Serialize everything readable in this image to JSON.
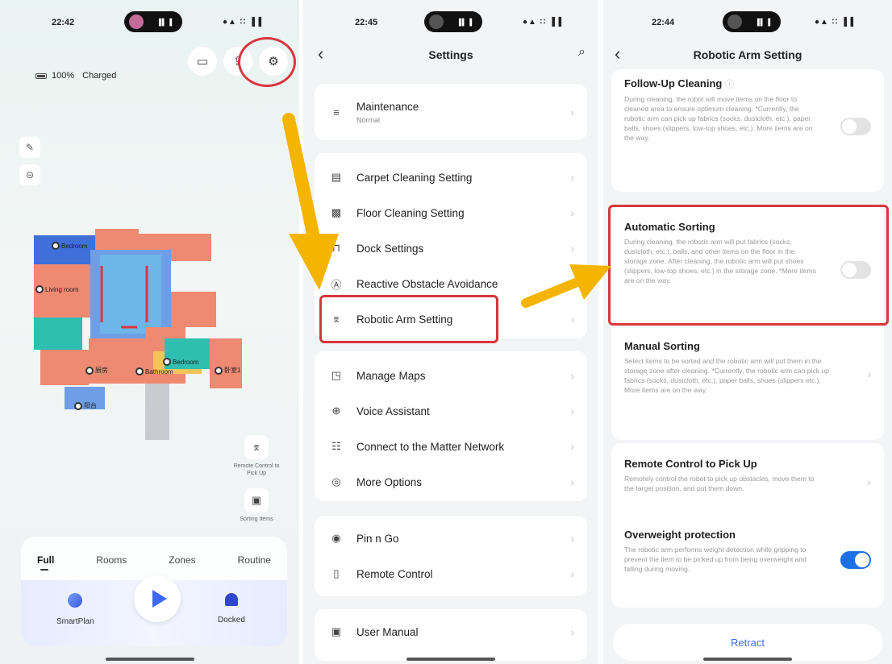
{
  "phone1": {
    "time": "22:42",
    "system_icons": "●▲ ∷ ▐▐",
    "battery": {
      "percent": "100%",
      "status": "Charged"
    },
    "top_icons": [
      "video-icon",
      "share-icon",
      "settings-gear-icon"
    ],
    "map_rooms": [
      {
        "label": "Bedroom"
      },
      {
        "label": "Living room"
      },
      {
        "label": "厨房"
      },
      {
        "label": "Bedroom"
      },
      {
        "label": "Bathroom"
      },
      {
        "label": "卧室1"
      },
      {
        "label": "阳台"
      }
    ],
    "remote_control": {
      "label": "Remote Control to Pick Up"
    },
    "sorting_items": {
      "label": "Sorting Items"
    },
    "mode_tabs": [
      "Full",
      "Rooms",
      "Zones",
      "Routine"
    ],
    "active_tab": "Full",
    "actions": {
      "left": "SmartPlan",
      "right": "Docked"
    }
  },
  "phone2": {
    "time": "22:45",
    "system_icons": "●▲ ∷ ▐▐",
    "title": "Settings",
    "groups": [
      [
        {
          "icon": "layers-icon",
          "glyph": "≡",
          "label": "Maintenance",
          "sub": "Normal"
        }
      ],
      [
        {
          "icon": "carpet-icon",
          "glyph": "▤",
          "label": "Carpet Cleaning Setting"
        },
        {
          "icon": "floor-icon",
          "glyph": "▩",
          "label": "Floor Cleaning Setting"
        },
        {
          "icon": "dock-icon",
          "glyph": "⊓",
          "label": "Dock Settings"
        },
        {
          "icon": "ai-icon",
          "glyph": "Ⓐ",
          "label": "Reactive Obstacle Avoidance"
        },
        {
          "icon": "robotic-arm-icon",
          "glyph": "⌆",
          "label": "Robotic Arm Setting"
        }
      ],
      [
        {
          "icon": "map-edit-icon",
          "glyph": "◳",
          "label": "Manage Maps"
        },
        {
          "icon": "voice-icon",
          "glyph": "⊕",
          "label": "Voice Assistant"
        },
        {
          "icon": "matter-icon",
          "glyph": "☷",
          "label": "Connect to the Matter Network"
        },
        {
          "icon": "more-icon",
          "glyph": "◎",
          "label": "More Options"
        }
      ],
      [
        {
          "icon": "pin-icon",
          "glyph": "◉",
          "label": "Pin n Go"
        },
        {
          "icon": "remote-icon",
          "glyph": "▯",
          "label": "Remote Control"
        }
      ],
      [
        {
          "icon": "manual-icon",
          "glyph": "▣",
          "label": "User Manual"
        }
      ]
    ]
  },
  "phone3": {
    "time": "22:44",
    "system_icons": "●▲ ∷ ▐▐",
    "title": "Robotic Arm Setting",
    "items": {
      "follow_up": {
        "title": "Follow-Up Cleaning",
        "desc": "During cleaning, the robot will move items on the floor to cleaned area to ensure optimum cleaning. *Currently, the robotic arm can pick up fabrics (socks, dustcloth, etc.), paper balls, shoes (slippers, low-top shoes, etc.). More items are on the way.",
        "enabled": false
      },
      "auto_sorting": {
        "title": "Automatic Sorting",
        "desc": "During cleaning, the robotic arm will put fabrics (socks, dustcloth, etc.), balls, and other items on the floor in the storage zone. After cleaning, the robotic arm will put shoes (slippers, low-top shoes, etc.) in the storage zone. *More items are on the way.",
        "enabled": false
      },
      "manual_sorting": {
        "title": "Manual Sorting",
        "desc": "Select items to be sorted and the robotic arm will put them in the storage zone after cleaning. *Currently, the robotic arm can pick up fabrics (socks, dustcloth, etc.), paper balls, shoes (slippers etc.). More items are on the way."
      },
      "remote_pickup": {
        "title": "Remote Control to Pick Up",
        "desc": "Remotely control the robot to pick up obstacles, move them to the target position, and put them down."
      },
      "overweight": {
        "title": "Overweight protection",
        "desc": "The robotic arm performs weight detection while gripping to prevent the item to be picked up from being overweight and falling during moving.",
        "enabled": true
      }
    },
    "retract_label": "Retract"
  },
  "colors": {
    "highlight": "#d9363e",
    "arrow": "#f4b400",
    "accent": "#1f6fe6"
  }
}
